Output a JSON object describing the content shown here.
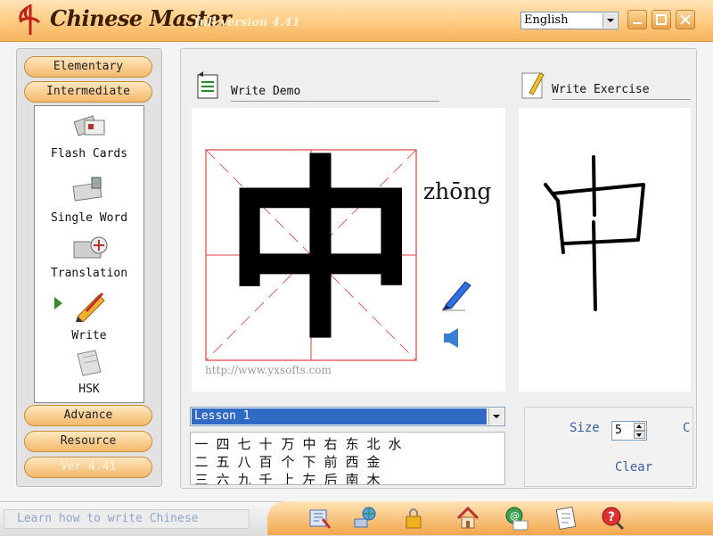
{
  "app": {
    "title": "Chinese Master",
    "version_tag": "full version 4.41",
    "language": "English"
  },
  "categories": {
    "elementary": "Elementary",
    "intermediate": "Intermediate",
    "advance": "Advance",
    "resource": "Resource",
    "version": "Ver 4.41"
  },
  "modules": [
    {
      "label": "Flash Cards",
      "icon": "flash-cards-icon"
    },
    {
      "label": "Single Word",
      "icon": "single-word-icon"
    },
    {
      "label": "Translation",
      "icon": "translation-icon"
    },
    {
      "label": "Write",
      "icon": "write-icon",
      "selected": true
    },
    {
      "label": "HSK",
      "icon": "hsk-icon"
    }
  ],
  "write_demo": {
    "title": "Write Demo",
    "character": "中",
    "pinyin": "zhōng",
    "url": "http://www.yxsofts.com"
  },
  "write_exercise": {
    "title": "Write Exercise"
  },
  "lesson": {
    "selected": "Lesson 1",
    "rows": [
      [
        "一",
        "四",
        "七",
        "十",
        "万",
        "中",
        "右",
        "东",
        "北",
        "水"
      ],
      [
        "二",
        "五",
        "八",
        "百",
        "个",
        "下",
        "前",
        "西",
        "金"
      ],
      [
        "三",
        "六",
        "九",
        "千",
        "上",
        "左",
        "后",
        "南",
        "木"
      ]
    ]
  },
  "controls": {
    "size_label": "Size",
    "size_value": "5",
    "color_label": "C",
    "clear_label": "Clear"
  },
  "status": {
    "text": "Learn how to write Chinese"
  },
  "toolbar": [
    "settings-icon",
    "network-icon",
    "lock-icon",
    "home-icon",
    "email-icon",
    "notes-icon",
    "help-icon"
  ],
  "colors": {
    "accent_orange": "#f6b35d",
    "selection_blue": "#316ac5",
    "grid_red": "#e04040",
    "link_blue": "#3a5fa8"
  }
}
